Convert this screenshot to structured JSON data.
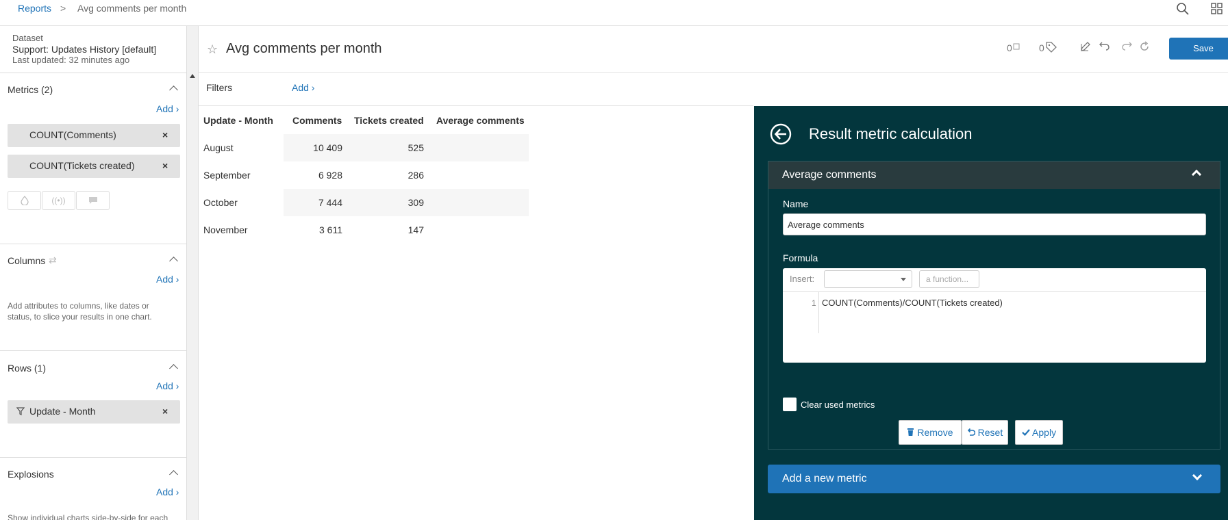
{
  "breadcrumb": {
    "root": "Reports",
    "separator": ">",
    "current": "Avg comments per month"
  },
  "dataset": {
    "label": "Dataset",
    "name": "Support: Updates History [default]",
    "updated": "Last updated: 32 minutes ago"
  },
  "sidebar": {
    "metrics": {
      "title": "Metrics (2)",
      "add": "Add ›",
      "items": [
        "COUNT(Comments)",
        "COUNT(Tickets created)"
      ]
    },
    "columns": {
      "title": "Columns",
      "add": "Add ›",
      "help": "Add attributes to columns, like dates or status, to slice your results in one chart."
    },
    "rows": {
      "title": "Rows (1)",
      "add": "Add ›",
      "items": [
        "Update - Month"
      ]
    },
    "explosions": {
      "title": "Explosions",
      "add": "Add ›",
      "help": "Show individual charts side-by-side for each attribute value."
    }
  },
  "header": {
    "title": "Avg comments per month",
    "comment_count": "0",
    "tag_count": "0",
    "save_label": "Save"
  },
  "filters": {
    "label": "Filters",
    "add": "Add ›"
  },
  "table": {
    "headers": [
      "Update - Month",
      "Comments",
      "Tickets created",
      "Average comments"
    ],
    "rows": [
      [
        "August",
        "10 409",
        "525",
        ""
      ],
      [
        "September",
        "6 928",
        "286",
        ""
      ],
      [
        "October",
        "7 444",
        "309",
        ""
      ],
      [
        "November",
        "3 611",
        "147",
        ""
      ]
    ]
  },
  "panel": {
    "title": "Result metric calculation",
    "card_title": "Average comments",
    "name_label": "Name",
    "name_value": "Average comments",
    "formula_label": "Formula",
    "insert_label": "Insert:",
    "function_placeholder": "a function...",
    "line_number": "1",
    "formula_code": "COUNT(Comments)/COUNT(Tickets created)",
    "clear_label": "Clear used metrics",
    "remove_label": "Remove",
    "reset_label": "Reset",
    "apply_label": "Apply",
    "add_new_label": "Add a new metric"
  },
  "colors": {
    "accent": "#1f73b7",
    "panel_bg": "#03363d",
    "card_header": "#293b3e"
  }
}
